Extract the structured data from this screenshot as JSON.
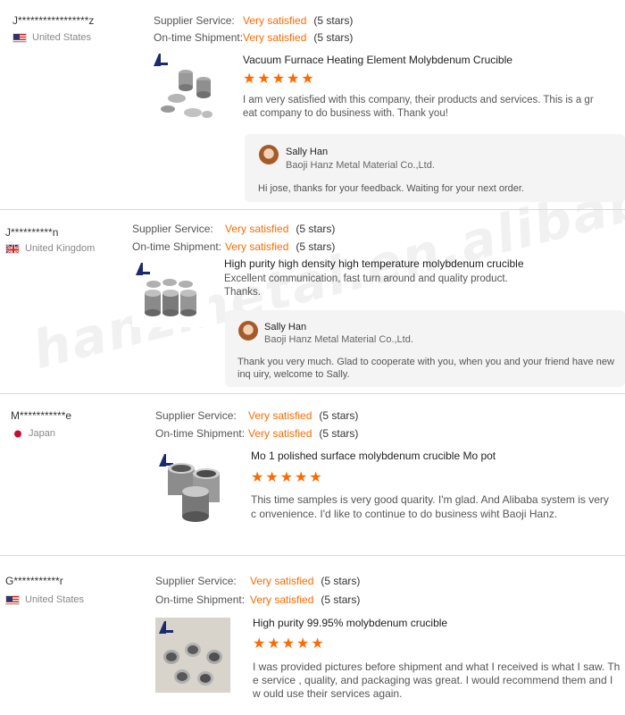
{
  "watermark": {
    "text": "hanzmetal.en.alibaba.com"
  },
  "labels": {
    "supplier_service": "Supplier Service:",
    "on_time_shipment": "On-time Shipment:"
  },
  "reviews": [
    {
      "buyer": "J*****************z",
      "country": "United States",
      "supplier_service": "Very satisfied",
      "supplier_service_stars": "(5 stars)",
      "shipment": "Very satisfied",
      "shipment_stars": "(5 stars)",
      "product_title": "Vacuum Furnace Heating Element Molybdenum Crucible",
      "star_rating": 5,
      "comment": "I am very satisfied with this company, their products and services. This is a gr eat company to do business with. Thank you!",
      "reply": {
        "name": "Sally Han",
        "company": "Baoji Hanz Metal Material Co.,Ltd.",
        "text": "Hi jose, thanks for your feedback. Waiting for your next order."
      }
    },
    {
      "buyer": "J**********n",
      "country": "United Kingdom",
      "supplier_service": "Very satisfied",
      "supplier_service_stars": "(5 stars)",
      "shipment": "Very satisfied",
      "shipment_stars": "(5 stars)",
      "product_title": "High purity high density high temperature molybdenum crucible",
      "comment": "Excellent communication, fast turn around and quality product. Thanks.",
      "reply": {
        "name": "Sally Han",
        "company": "Baoji Hanz Metal Material Co.,Ltd.",
        "text": "Thank you very much. Glad to cooperate with you, when you and your friend have new inq uiry, welcome to Sally."
      }
    },
    {
      "buyer": "M***********e",
      "country": "Japan",
      "supplier_service": "Very satisfied",
      "supplier_service_stars": "(5 stars)",
      "shipment": "Very satisfied",
      "shipment_stars": "(5 stars)",
      "product_title": "Mo 1 polished surface molybdenum crucible Mo pot",
      "star_rating": 5,
      "comment": "This time samples is very good quarity. I'm glad. And Alibaba system is very c onvenience. I'd like to continue to do business wiht Baoji Hanz."
    },
    {
      "buyer": "G***********r",
      "country": "United States",
      "supplier_service": "Very satisfied",
      "supplier_service_stars": "(5 stars)",
      "shipment": "Very satisfied",
      "shipment_stars": "(5 stars)",
      "product_title": "High purity 99.95% molybdenum crucible",
      "star_rating": 5,
      "comment": "I was provided pictures before shipment and what I received is what I saw. Th e service , quality, and packaging was great. I would recommend them and I w ould use their services again."
    }
  ],
  "colors": {
    "accent": "#ff6a00",
    "divider": "#d9d9d9",
    "reply_bg": "#f4f4f4"
  },
  "icons": [
    "us-flag-icon",
    "uk-flag-icon",
    "japan-flag-icon",
    "star-icon",
    "avatar",
    "hanz-logo-icon",
    "crucible-product-image"
  ]
}
